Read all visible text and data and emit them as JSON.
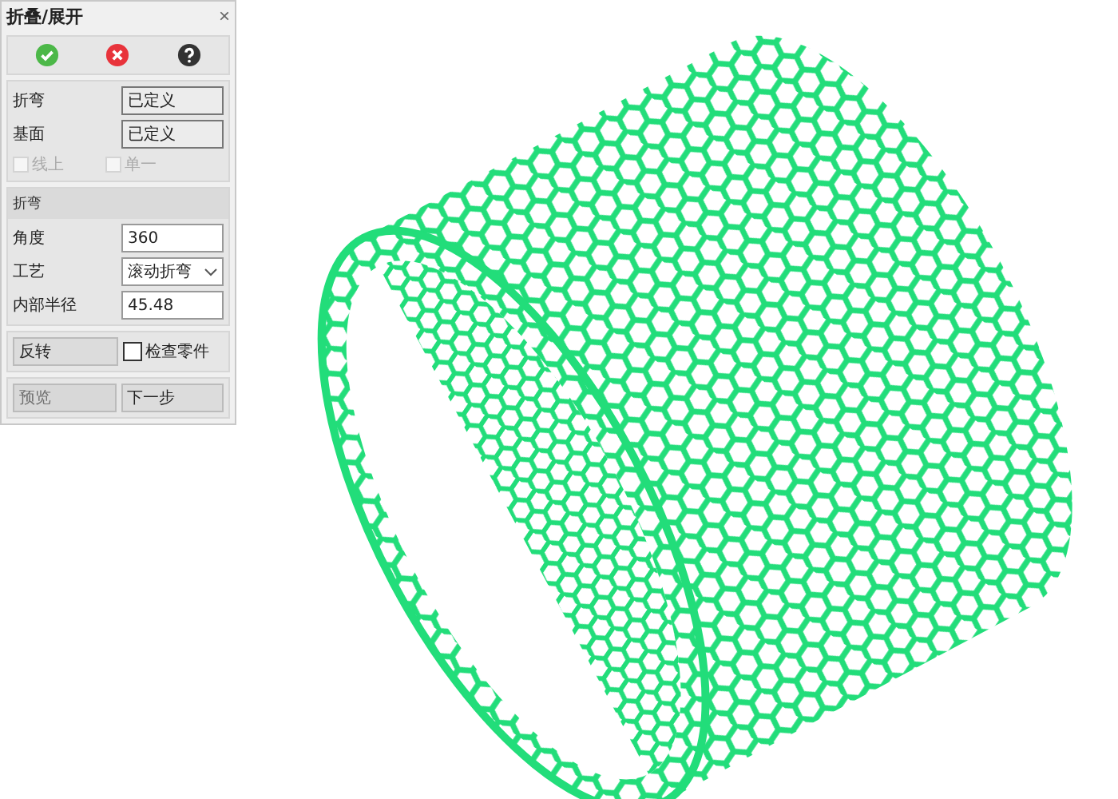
{
  "window": {
    "title": "折叠/展开",
    "close": "×"
  },
  "references": [
    {
      "label": "折弯",
      "value": "已定义"
    },
    {
      "label": "基面",
      "value": "已定义"
    }
  ],
  "options": [
    {
      "label": "线上",
      "checked": false,
      "disabled": true
    },
    {
      "label": "单一",
      "checked": false,
      "disabled": true
    }
  ],
  "bend": {
    "heading": "折弯",
    "fields": [
      {
        "kind": "input",
        "label": "角度",
        "value": "360"
      },
      {
        "kind": "select",
        "label": "工艺",
        "value": "滚动折弯"
      },
      {
        "kind": "input",
        "label": "内部半径",
        "value": "45.48"
      }
    ]
  },
  "reverse_button": "反转",
  "check_parts": {
    "label": "检查零件",
    "checked": false
  },
  "buttons": [
    {
      "label": "预览",
      "disabled": true
    },
    {
      "label": "下一步",
      "disabled": false
    }
  ]
}
